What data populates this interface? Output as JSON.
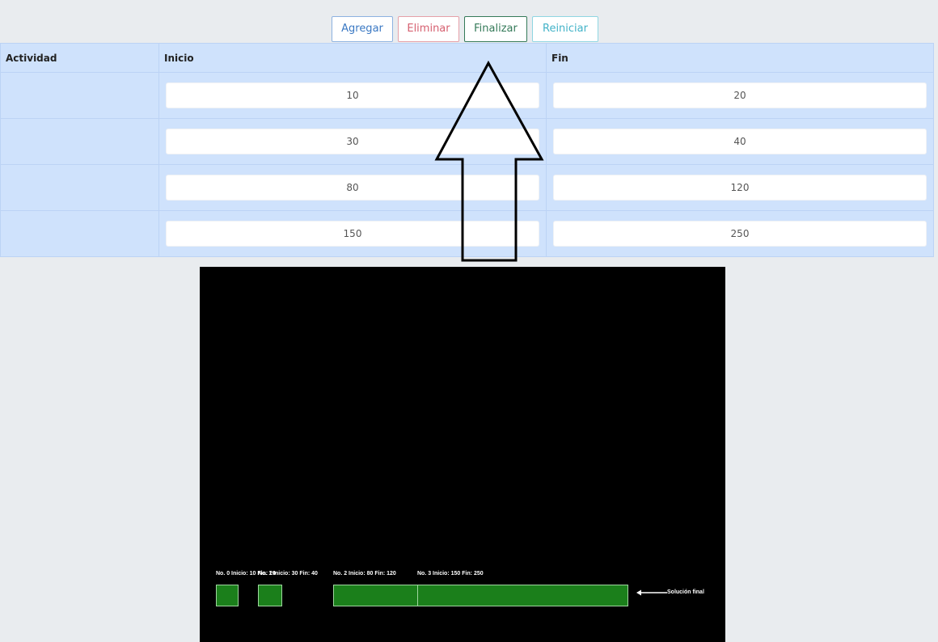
{
  "toolbar": {
    "agregar": "Agregar",
    "eliminar": "Eliminar",
    "finalizar": "Finalizar",
    "reiniciar": "Reiniciar"
  },
  "table": {
    "headers": [
      "Actividad",
      "Inicio",
      "Fin"
    ],
    "rows": [
      {
        "actividad": "",
        "inicio": "10",
        "fin": "20"
      },
      {
        "actividad": "",
        "inicio": "30",
        "fin": "40"
      },
      {
        "actividad": "",
        "inicio": "80",
        "fin": "120"
      },
      {
        "actividad": "",
        "inicio": "150",
        "fin": "250"
      }
    ]
  },
  "canvas": {
    "labels": [
      "No. 0 Inicio: 10 Fin: 20",
      "No. 1 Inicio: 30 Fin: 40",
      "No. 2 Inicio: 80 Fin: 120",
      "No. 3 Inicio: 150 Fin: 250"
    ],
    "final_label": "Solución final",
    "block_color": "#1b7f1b",
    "background": "#000000"
  },
  "colors": {
    "page_bg": "#e9ecef",
    "table_bg": "#cfe2fc",
    "agregar": "#3a78c3",
    "eliminar": "#d66070",
    "finalizar": "#357a59",
    "reiniciar": "#43b3c8"
  }
}
